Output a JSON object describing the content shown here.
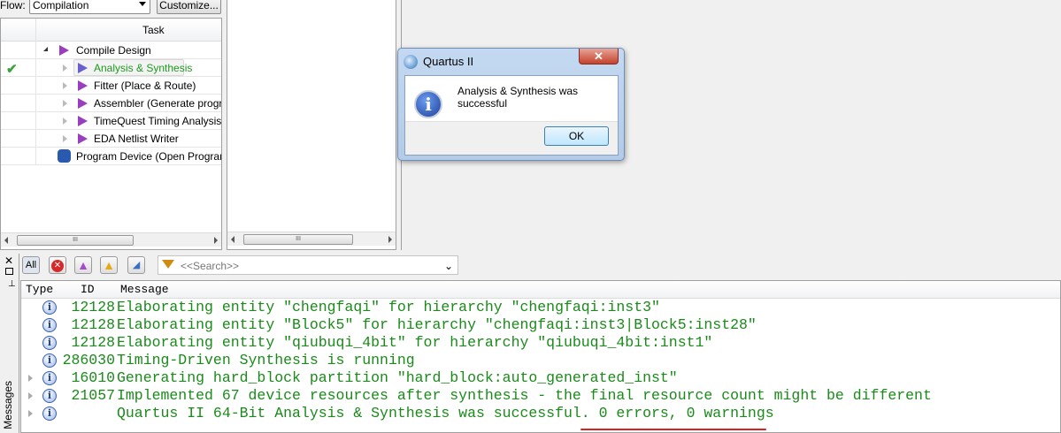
{
  "flow": {
    "label": "Flow:",
    "value": "Compilation",
    "customize": "Customize..."
  },
  "tasks": {
    "header": "Task",
    "items": [
      {
        "label": "Compile Design"
      },
      {
        "label": "Analysis & Synthesis",
        "status": "success"
      },
      {
        "label": "Fitter (Place & Route)"
      },
      {
        "label": "Assembler (Generate programming files)"
      },
      {
        "label": "TimeQuest Timing Analysis"
      },
      {
        "label": "EDA Netlist Writer"
      },
      {
        "label": "Program Device (Open Programmer)"
      }
    ]
  },
  "dialog": {
    "title": "Quartus II",
    "message": "Analysis & Synthesis was successful",
    "ok": "OK",
    "close": "✕"
  },
  "messages": {
    "side_label": "Messages",
    "toolbar": {
      "all": "All",
      "search_placeholder": "<<Search>>"
    },
    "columns": {
      "type": "Type",
      "id": "ID",
      "message": "Message"
    },
    "rows": [
      {
        "id": "12128",
        "text": "Elaborating entity \"chengfaqi\" for hierarchy \"chengfaqi:inst3\""
      },
      {
        "id": "12128",
        "text": "Elaborating entity \"Block5\" for hierarchy \"chengfaqi:inst3|Block5:inst28\""
      },
      {
        "id": "12128",
        "text": "Elaborating entity \"qiubuqi_4bit\" for hierarchy \"qiubuqi_4bit:inst1\""
      },
      {
        "id": "286030",
        "text": "Timing-Driven Synthesis is running"
      },
      {
        "id": "16010",
        "text": "Generating hard_block partition \"hard_block:auto_generated_inst\""
      },
      {
        "id": "21057",
        "text": "Implemented 67 device resources after synthesis - the final resource count might be different"
      },
      {
        "id": "",
        "text": "Quartus II 64-Bit Analysis & Synthesis was successful. 0 errors, 0 warnings"
      }
    ]
  }
}
